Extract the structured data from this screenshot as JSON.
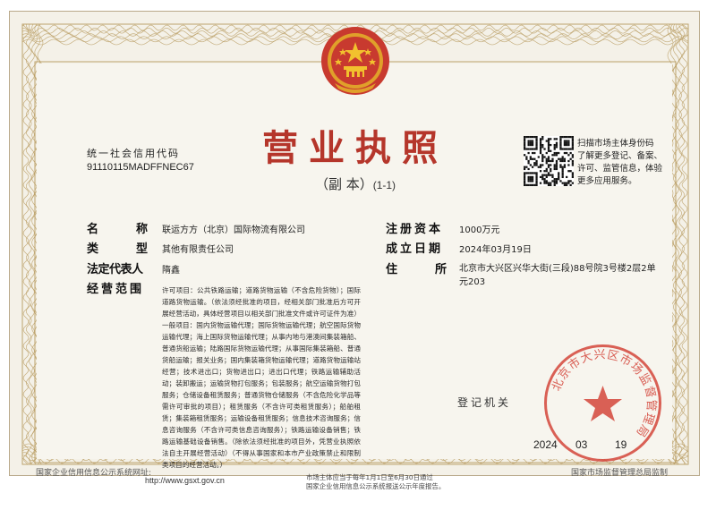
{
  "header": {
    "credit_code_label": "统一社会信用代码",
    "credit_code": "91110115MADFFNEC67",
    "title": "营业执照",
    "subtitle": "（副 本）",
    "subtitle_number": "(1-1)"
  },
  "qr": {
    "lines": [
      "扫描市场主体身份码",
      "了解更多登记、备案、",
      "许可、监管信息，体验",
      "更多应用服务。"
    ]
  },
  "fields": {
    "name_label": [
      "名",
      "称"
    ],
    "name_value": "联运方方（北京）国际物流有限公司",
    "type_label": [
      "类",
      "型"
    ],
    "type_value": "其他有限责任公司",
    "legal_rep_label": "法定代表人",
    "legal_rep_value": "隋鑫",
    "scope_label": "经营范围",
    "scope_value": "许可项目：公共铁路运输；道路货物运输（不含危险货物）；国际道路货物运输。（依法须经批准的项目，经相关部门批准后方可开展经营活动，具体经营项目以相关部门批准文件或许可证件为准）一般项目：国内货物运输代理；国际货物运输代理；航空国际货物运输代理；海上国际货物运输代理；从事内地与港澳间集装箱船、普通货船运输；陆路国际货物运输代理；从事国际集装箱船、普通货船运输；报关业务；国内集装箱货物运输代理；道路货物运输站经营；技术进出口；货物进出口；进出口代理；铁路运输辅助活动；装卸搬运；运输货物打包服务；包装服务；航空运输货物打包服务；仓储设备租赁服务；普通货物仓储服务（不含危险化学品等需许可审批的项目）；租赁服务（不含许可类租赁服务）；船舶租赁；集装箱租赁服务；运输设备租赁服务；信息技术咨询服务；信息咨询服务（不含许可类信息咨询服务）；铁路运输设备销售；铁路运输基础设备销售。（除依法须经批准的项目外，凭营业执照依法自主开展经营活动）（不得从事国家和本市产业政策禁止和限制类项目的经营活动。）",
    "capital_label": "注册资本",
    "capital_value": "1000万元",
    "established_label": "成立日期",
    "established_value": "2024年03月19日",
    "address_label": [
      "住",
      "所"
    ],
    "address_lines": [
      "北京市大兴区兴华大街(三段)88号院3号楼2层2单",
      "元203"
    ]
  },
  "issue": {
    "registrar_label": "登记机关",
    "stamp_text": "北京市大兴区市场监督管理局",
    "year": "2024",
    "month": "03",
    "day": "19"
  },
  "footer": {
    "left": "国家企业信用信息公示系统网址:",
    "url": "http://www.gsxt.gov.cn",
    "mid_lines": [
      "市场主体应当于每年1月1日至6月30日通过",
      "国家企业信用信息公示系统报送公示年度报告。"
    ],
    "right": "国家市场监督管理总局监制"
  },
  "colors": {
    "title_red": "#b5362b",
    "stamp_red": "#d4453a",
    "border_gold": "#b79a5e",
    "paper": "#f4f1e8"
  }
}
